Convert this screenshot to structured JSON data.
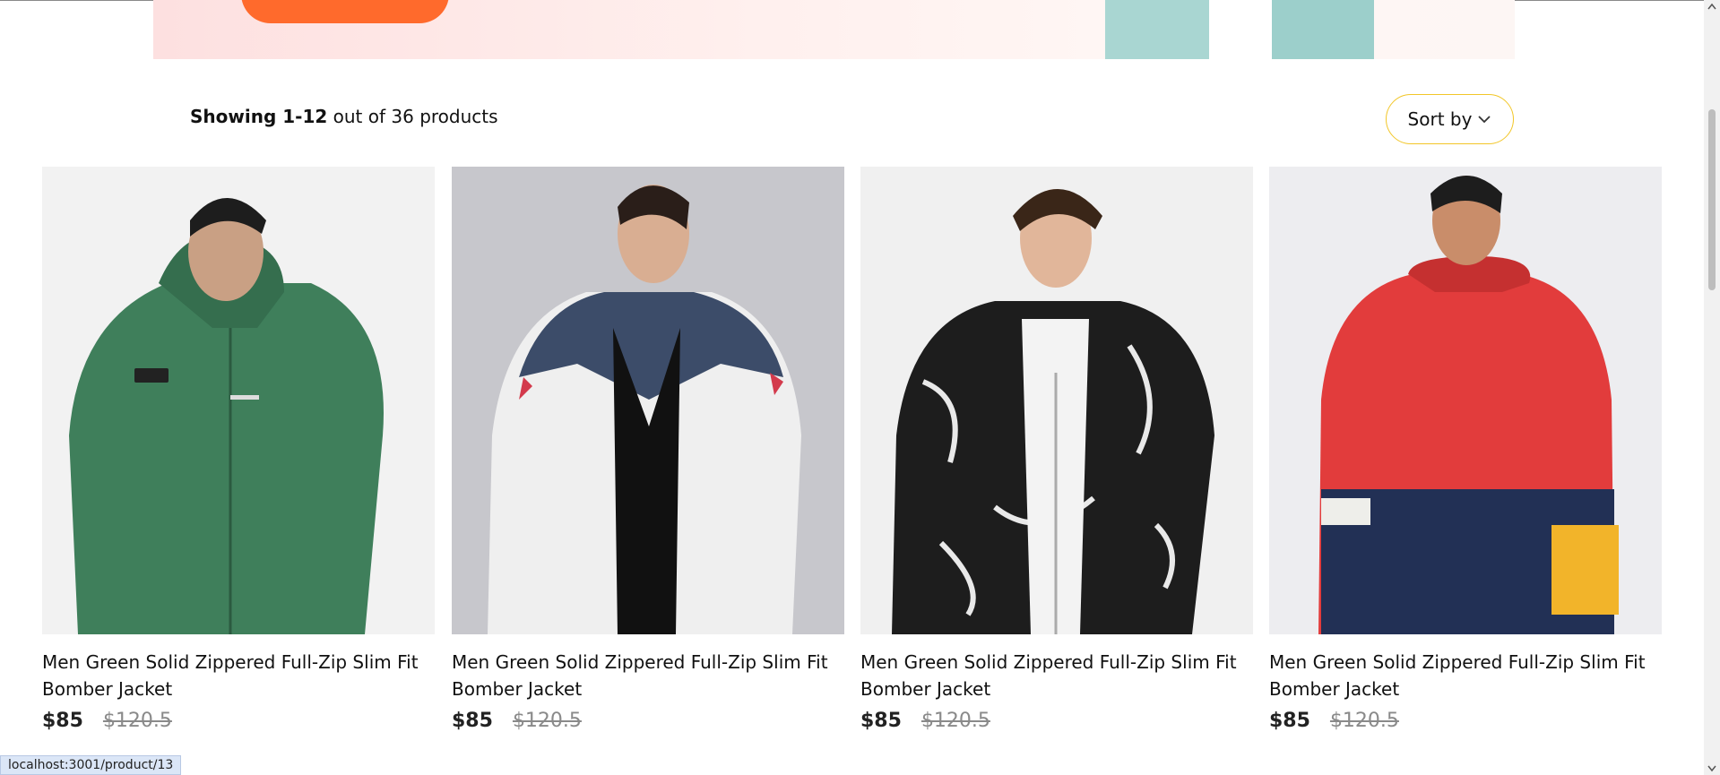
{
  "toolbar": {
    "showing_bold": "Showing 1-12",
    "showing_rest": " out of 36 products",
    "sort_label": "Sort by"
  },
  "products": [
    {
      "title": "Men Green Solid Zippered Full-Zip Slim Fit Bomber Jacket",
      "price": "$85",
      "old_price": "$120.5",
      "bg": "#f2f2f2",
      "jacket": "#3f7f5b"
    },
    {
      "title": "Men Green Solid Zippered Full-Zip Slim Fit Bomber Jacket",
      "price": "$85",
      "old_price": "$120.5",
      "bg": "#c7c7cc",
      "jacket": "#efefef"
    },
    {
      "title": "Men Green Solid Zippered Full-Zip Slim Fit Bomber Jacket",
      "price": "$85",
      "old_price": "$120.5",
      "bg": "#f0f0f0",
      "jacket": "#1d1d1d"
    },
    {
      "title": "Men Green Solid Zippered Full-Zip Slim Fit Bomber Jacket",
      "price": "$85",
      "old_price": "$120.5",
      "bg": "#ededf0",
      "jacket": "#e23c3c"
    }
  ],
  "status_url": "localhost:3001/product/13",
  "colors": {
    "accent": "#ff6a2c",
    "sort_border": "#f2c628"
  }
}
